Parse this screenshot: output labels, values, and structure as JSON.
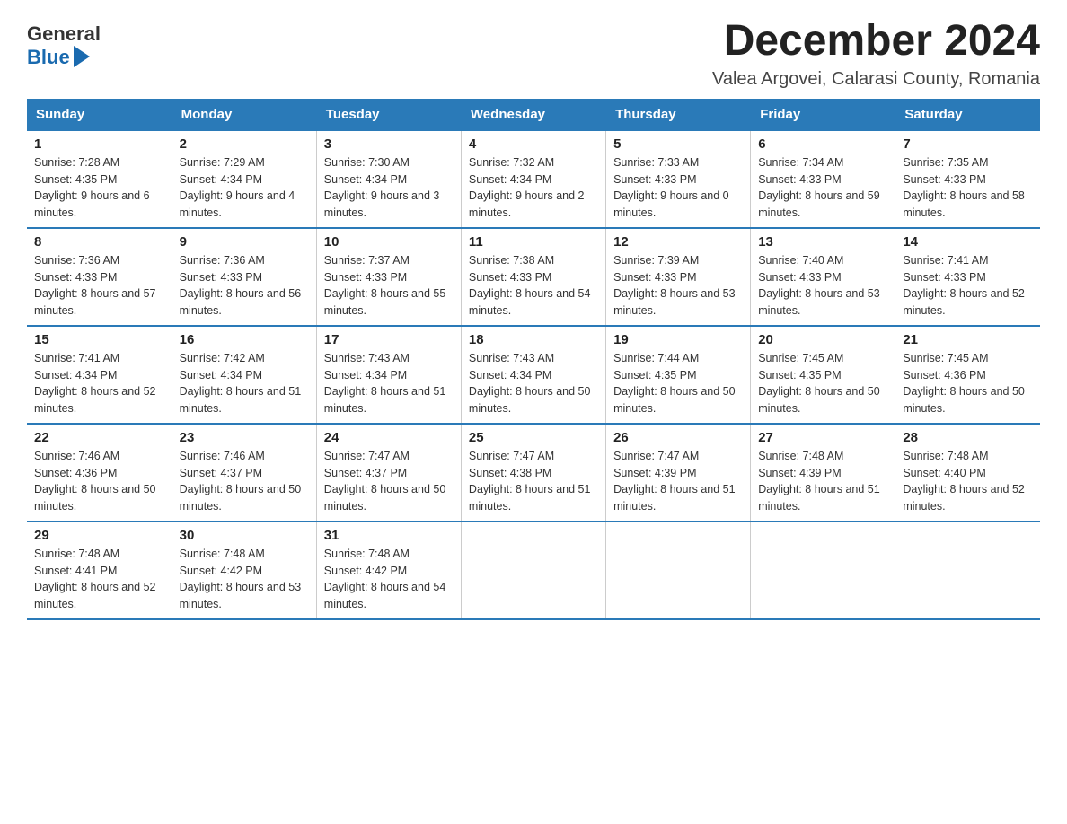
{
  "logo": {
    "general": "General",
    "blue": "Blue"
  },
  "header": {
    "month_year": "December 2024",
    "location": "Valea Argovei, Calarasi County, Romania"
  },
  "columns": [
    "Sunday",
    "Monday",
    "Tuesday",
    "Wednesday",
    "Thursday",
    "Friday",
    "Saturday"
  ],
  "weeks": [
    [
      {
        "day": "1",
        "sunrise": "Sunrise: 7:28 AM",
        "sunset": "Sunset: 4:35 PM",
        "daylight": "Daylight: 9 hours and 6 minutes."
      },
      {
        "day": "2",
        "sunrise": "Sunrise: 7:29 AM",
        "sunset": "Sunset: 4:34 PM",
        "daylight": "Daylight: 9 hours and 4 minutes."
      },
      {
        "day": "3",
        "sunrise": "Sunrise: 7:30 AM",
        "sunset": "Sunset: 4:34 PM",
        "daylight": "Daylight: 9 hours and 3 minutes."
      },
      {
        "day": "4",
        "sunrise": "Sunrise: 7:32 AM",
        "sunset": "Sunset: 4:34 PM",
        "daylight": "Daylight: 9 hours and 2 minutes."
      },
      {
        "day": "5",
        "sunrise": "Sunrise: 7:33 AM",
        "sunset": "Sunset: 4:33 PM",
        "daylight": "Daylight: 9 hours and 0 minutes."
      },
      {
        "day": "6",
        "sunrise": "Sunrise: 7:34 AM",
        "sunset": "Sunset: 4:33 PM",
        "daylight": "Daylight: 8 hours and 59 minutes."
      },
      {
        "day": "7",
        "sunrise": "Sunrise: 7:35 AM",
        "sunset": "Sunset: 4:33 PM",
        "daylight": "Daylight: 8 hours and 58 minutes."
      }
    ],
    [
      {
        "day": "8",
        "sunrise": "Sunrise: 7:36 AM",
        "sunset": "Sunset: 4:33 PM",
        "daylight": "Daylight: 8 hours and 57 minutes."
      },
      {
        "day": "9",
        "sunrise": "Sunrise: 7:36 AM",
        "sunset": "Sunset: 4:33 PM",
        "daylight": "Daylight: 8 hours and 56 minutes."
      },
      {
        "day": "10",
        "sunrise": "Sunrise: 7:37 AM",
        "sunset": "Sunset: 4:33 PM",
        "daylight": "Daylight: 8 hours and 55 minutes."
      },
      {
        "day": "11",
        "sunrise": "Sunrise: 7:38 AM",
        "sunset": "Sunset: 4:33 PM",
        "daylight": "Daylight: 8 hours and 54 minutes."
      },
      {
        "day": "12",
        "sunrise": "Sunrise: 7:39 AM",
        "sunset": "Sunset: 4:33 PM",
        "daylight": "Daylight: 8 hours and 53 minutes."
      },
      {
        "day": "13",
        "sunrise": "Sunrise: 7:40 AM",
        "sunset": "Sunset: 4:33 PM",
        "daylight": "Daylight: 8 hours and 53 minutes."
      },
      {
        "day": "14",
        "sunrise": "Sunrise: 7:41 AM",
        "sunset": "Sunset: 4:33 PM",
        "daylight": "Daylight: 8 hours and 52 minutes."
      }
    ],
    [
      {
        "day": "15",
        "sunrise": "Sunrise: 7:41 AM",
        "sunset": "Sunset: 4:34 PM",
        "daylight": "Daylight: 8 hours and 52 minutes."
      },
      {
        "day": "16",
        "sunrise": "Sunrise: 7:42 AM",
        "sunset": "Sunset: 4:34 PM",
        "daylight": "Daylight: 8 hours and 51 minutes."
      },
      {
        "day": "17",
        "sunrise": "Sunrise: 7:43 AM",
        "sunset": "Sunset: 4:34 PM",
        "daylight": "Daylight: 8 hours and 51 minutes."
      },
      {
        "day": "18",
        "sunrise": "Sunrise: 7:43 AM",
        "sunset": "Sunset: 4:34 PM",
        "daylight": "Daylight: 8 hours and 50 minutes."
      },
      {
        "day": "19",
        "sunrise": "Sunrise: 7:44 AM",
        "sunset": "Sunset: 4:35 PM",
        "daylight": "Daylight: 8 hours and 50 minutes."
      },
      {
        "day": "20",
        "sunrise": "Sunrise: 7:45 AM",
        "sunset": "Sunset: 4:35 PM",
        "daylight": "Daylight: 8 hours and 50 minutes."
      },
      {
        "day": "21",
        "sunrise": "Sunrise: 7:45 AM",
        "sunset": "Sunset: 4:36 PM",
        "daylight": "Daylight: 8 hours and 50 minutes."
      }
    ],
    [
      {
        "day": "22",
        "sunrise": "Sunrise: 7:46 AM",
        "sunset": "Sunset: 4:36 PM",
        "daylight": "Daylight: 8 hours and 50 minutes."
      },
      {
        "day": "23",
        "sunrise": "Sunrise: 7:46 AM",
        "sunset": "Sunset: 4:37 PM",
        "daylight": "Daylight: 8 hours and 50 minutes."
      },
      {
        "day": "24",
        "sunrise": "Sunrise: 7:47 AM",
        "sunset": "Sunset: 4:37 PM",
        "daylight": "Daylight: 8 hours and 50 minutes."
      },
      {
        "day": "25",
        "sunrise": "Sunrise: 7:47 AM",
        "sunset": "Sunset: 4:38 PM",
        "daylight": "Daylight: 8 hours and 51 minutes."
      },
      {
        "day": "26",
        "sunrise": "Sunrise: 7:47 AM",
        "sunset": "Sunset: 4:39 PM",
        "daylight": "Daylight: 8 hours and 51 minutes."
      },
      {
        "day": "27",
        "sunrise": "Sunrise: 7:48 AM",
        "sunset": "Sunset: 4:39 PM",
        "daylight": "Daylight: 8 hours and 51 minutes."
      },
      {
        "day": "28",
        "sunrise": "Sunrise: 7:48 AM",
        "sunset": "Sunset: 4:40 PM",
        "daylight": "Daylight: 8 hours and 52 minutes."
      }
    ],
    [
      {
        "day": "29",
        "sunrise": "Sunrise: 7:48 AM",
        "sunset": "Sunset: 4:41 PM",
        "daylight": "Daylight: 8 hours and 52 minutes."
      },
      {
        "day": "30",
        "sunrise": "Sunrise: 7:48 AM",
        "sunset": "Sunset: 4:42 PM",
        "daylight": "Daylight: 8 hours and 53 minutes."
      },
      {
        "day": "31",
        "sunrise": "Sunrise: 7:48 AM",
        "sunset": "Sunset: 4:42 PM",
        "daylight": "Daylight: 8 hours and 54 minutes."
      },
      null,
      null,
      null,
      null
    ]
  ]
}
